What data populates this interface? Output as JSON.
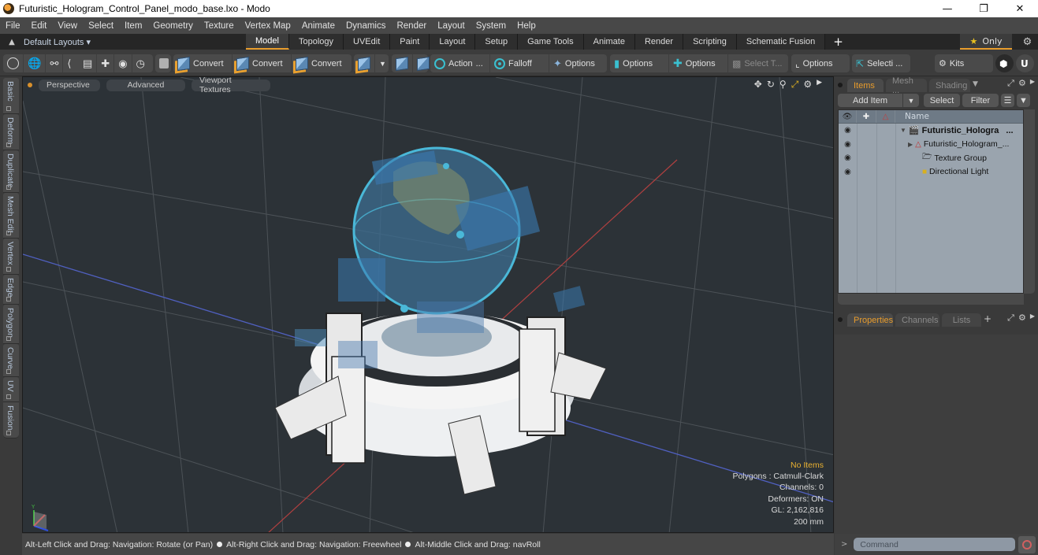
{
  "window": {
    "title": "Futuristic_Hologram_Control_Panel_modo_base.lxo - Modo",
    "controls": [
      "minimize",
      "restore",
      "close"
    ]
  },
  "menu": [
    "File",
    "Edit",
    "View",
    "Select",
    "Item",
    "Geometry",
    "Texture",
    "Vertex Map",
    "Animate",
    "Dynamics",
    "Render",
    "Layout",
    "System",
    "Help"
  ],
  "layout_bar": {
    "preset_label": "Default Layouts",
    "tabs": [
      "Model",
      "Topology",
      "UVEdit",
      "Paint",
      "Layout",
      "Setup",
      "Game Tools",
      "Animate",
      "Render",
      "Scripting",
      "Schematic Fusion"
    ],
    "active_tab": "Model",
    "add_label": "+",
    "only_label": "Only"
  },
  "toolbar": {
    "convert1": "Convert",
    "convert2": "Convert",
    "convert3": "Convert",
    "action": "Action",
    "action_more": "...",
    "falloff": "Falloff",
    "options1": "Options",
    "options2": "Options",
    "options3": "Options",
    "select_t": "Select T...",
    "options4": "Options",
    "selecti": "Selecti ...",
    "kits": "Kits"
  },
  "left_tabs": [
    "Basic",
    "Deform",
    "Duplicate",
    "Mesh Edit",
    "Vertex",
    "Edge",
    "Polygon",
    "Curve",
    "UV",
    "Fusion"
  ],
  "viewport": {
    "view_mode": "Perspective",
    "shading": "Advanced",
    "textures": "Viewport Textures",
    "info": {
      "selection": "No Items",
      "polygons": "Polygons : Catmull-Clark",
      "channels": "Channels: 0",
      "deformers": "Deformers: ON",
      "gl": "GL: 2,162,816",
      "scale": "200 mm"
    }
  },
  "status_bar": {
    "hint1": "Alt-Left Click and Drag: Navigation: Rotate (or Pan)",
    "hint2": "Alt-Right Click and Drag: Navigation: Freewheel",
    "hint3": "Alt-Middle Click and Drag: navRoll"
  },
  "items_panel": {
    "tabs": [
      "Items",
      "Mesh ...",
      "Shading"
    ],
    "active_tab": "Items",
    "add_item": "Add Item",
    "select": "Select",
    "filter": "Filter",
    "name_header": "Name",
    "tree": [
      {
        "label": "Futuristic_Hologra",
        "suffix": "...",
        "type": "scene",
        "bold": true,
        "level": 0
      },
      {
        "label": "Futuristic_Hologram_...",
        "type": "mesh",
        "level": 1
      },
      {
        "label": "Texture Group",
        "type": "texture-group",
        "level": 1
      },
      {
        "label": "Directional Light",
        "type": "light",
        "level": 1
      }
    ]
  },
  "properties_panel": {
    "tabs": [
      "Properties",
      "Channels",
      "Lists"
    ],
    "active_tab": "Properties",
    "add_label": "+"
  },
  "command": {
    "prompt": ">",
    "placeholder": "Command"
  }
}
